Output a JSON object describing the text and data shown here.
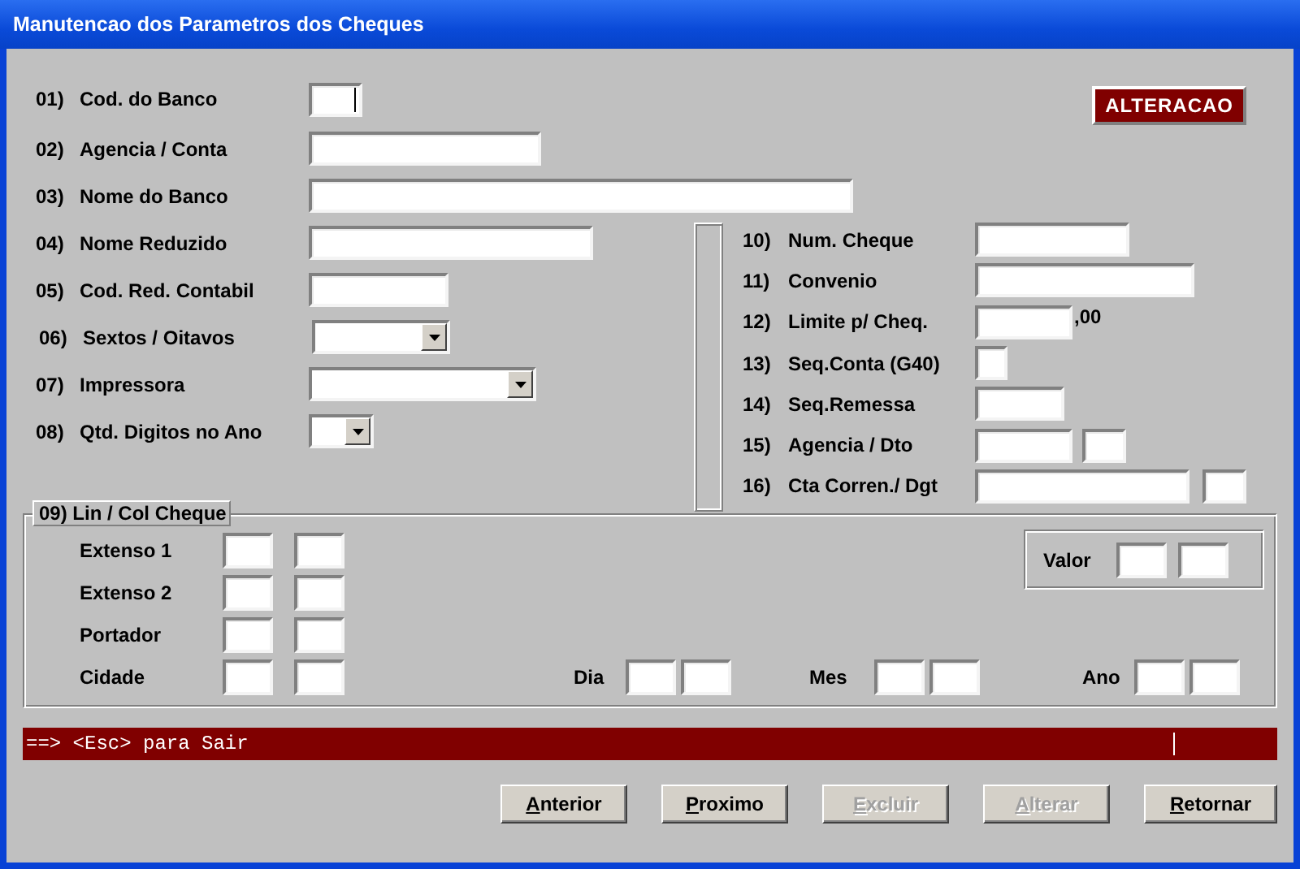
{
  "window": {
    "title": "Manutencao dos Parametros dos Cheques"
  },
  "mode_badge": "ALTERACAO",
  "left_fields": [
    {
      "number": "01)",
      "label": "Cod. do Banco",
      "kind": "text",
      "focused": true
    },
    {
      "number": "02)",
      "label": "Agencia / Conta",
      "kind": "text",
      "focused": false
    },
    {
      "number": "03)",
      "label": "Nome do Banco",
      "kind": "text",
      "focused": false
    },
    {
      "number": "04)",
      "label": "Nome Reduzido",
      "kind": "text",
      "focused": false
    },
    {
      "number": "05)",
      "label": "Cod. Red. Contabil",
      "kind": "text",
      "focused": false
    },
    {
      "number": "06)",
      "label": "Sextos / Oitavos",
      "kind": "combo",
      "focused": false
    },
    {
      "number": "07)",
      "label": "Impressora",
      "kind": "combo",
      "focused": false
    },
    {
      "number": "08)",
      "label": "Qtd. Digitos no Ano",
      "kind": "combo",
      "focused": false
    }
  ],
  "right_fields": [
    {
      "number": "10)",
      "label": "Num. Cheque",
      "kind": "text"
    },
    {
      "number": "11)",
      "label": "Convenio",
      "kind": "text"
    },
    {
      "number": "12)",
      "label": "Limite p/ Cheq.",
      "kind": "suffix",
      "suffix": ",00"
    },
    {
      "number": "13)",
      "label": "Seq.Conta (G40)",
      "kind": "text"
    },
    {
      "number": "14)",
      "label": "Seq.Remessa",
      "kind": "text"
    },
    {
      "number": "15)",
      "label": "Agencia / Dto",
      "kind": "pair"
    },
    {
      "number": "16)",
      "label": "Cta Corren./ Dgt",
      "kind": "pair"
    }
  ],
  "cheque_layout": {
    "title": "09) Lin / Col Cheque",
    "rows": [
      "Extenso 1",
      "Extenso 2",
      "Portador",
      "Cidade"
    ],
    "valor": "Valor",
    "date_parts": [
      "Dia",
      "Mes",
      "Ano"
    ]
  },
  "status_bar": "==> <Esc> para Sair",
  "buttons": [
    {
      "label": "Anterior",
      "disabled": false,
      "mnemonic": true
    },
    {
      "label": "Proximo",
      "disabled": false,
      "mnemonic": true
    },
    {
      "label": "Excluir",
      "disabled": true,
      "mnemonic": true
    },
    {
      "label": "Alterar",
      "disabled": true,
      "mnemonic": true
    },
    {
      "label": "Retornar",
      "disabled": false,
      "mnemonic": true
    }
  ]
}
